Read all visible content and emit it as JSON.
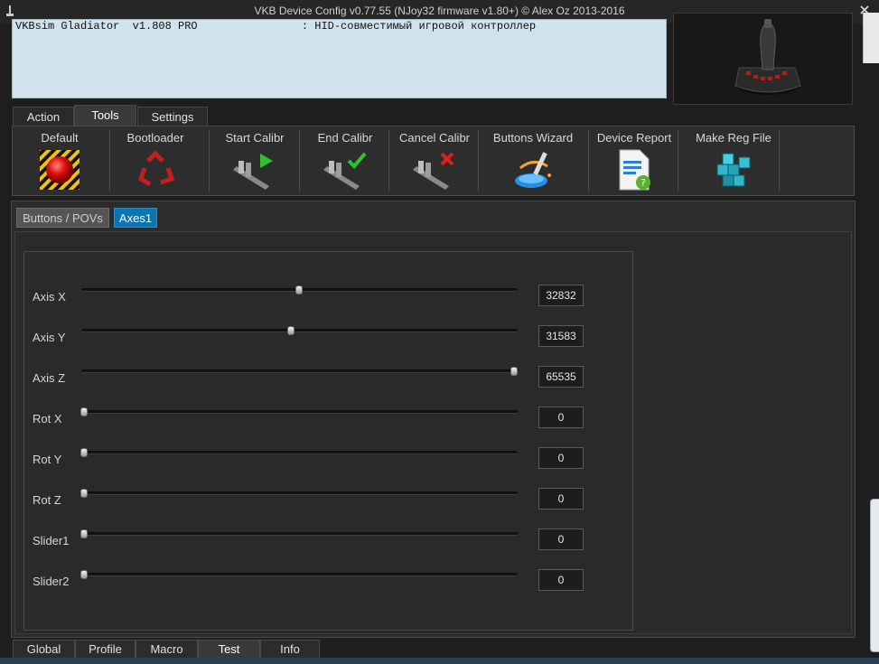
{
  "window": {
    "title": "VKB Device Config v0.77.55 (NJoy32 firmware v1.80+) © Alex Oz 2013-2016"
  },
  "device_list": {
    "line": "VKBsim Gladiator  v1.808 PRO                : HID-совместимый игровой контроллер"
  },
  "main_tabs": [
    {
      "label": "Action"
    },
    {
      "label": "Tools",
      "active": true
    },
    {
      "label": "Settings"
    }
  ],
  "toolbar": [
    {
      "label": "Default",
      "icon": "red-button-icon"
    },
    {
      "label": "Bootloader",
      "icon": "recycle-icon"
    },
    {
      "label": "Start Calibr",
      "icon": "caliper-play-icon"
    },
    {
      "label": "End Calibr",
      "icon": "caliper-check-icon"
    },
    {
      "label": "Cancel Calibr",
      "icon": "caliper-cancel-icon"
    },
    {
      "label": "Buttons Wizard",
      "icon": "magic-wand-icon"
    },
    {
      "label": "Device Report",
      "icon": "document-help-icon"
    },
    {
      "label": "Make Reg File",
      "icon": "registry-cubes-icon"
    }
  ],
  "sub_tabs": [
    {
      "label": "Buttons / POVs"
    },
    {
      "label": "Axes1",
      "active": true
    }
  ],
  "axes": [
    {
      "label": "Axis X",
      "value": "32832",
      "fraction": 0.501
    },
    {
      "label": "Axis Y",
      "value": "31583",
      "fraction": 0.482
    },
    {
      "label": "Axis Z",
      "value": "65535",
      "fraction": 1.0
    },
    {
      "label": "Rot X",
      "value": "0",
      "fraction": 0
    },
    {
      "label": "Rot Y",
      "value": "0",
      "fraction": 0
    },
    {
      "label": "Rot Z",
      "value": "0",
      "fraction": 0
    },
    {
      "label": "Slider1",
      "value": "0",
      "fraction": 0
    },
    {
      "label": "Slider2",
      "value": "0",
      "fraction": 0
    }
  ],
  "bottom_tabs": [
    {
      "label": "Global"
    },
    {
      "label": "Profile"
    },
    {
      "label": "Macro"
    },
    {
      "label": "Test",
      "active": true
    },
    {
      "label": "Info"
    }
  ],
  "colors": {
    "accent": "#0d74b2",
    "device_list_bg": "#cfe2ee",
    "window_bg": "#1e1e1e"
  }
}
